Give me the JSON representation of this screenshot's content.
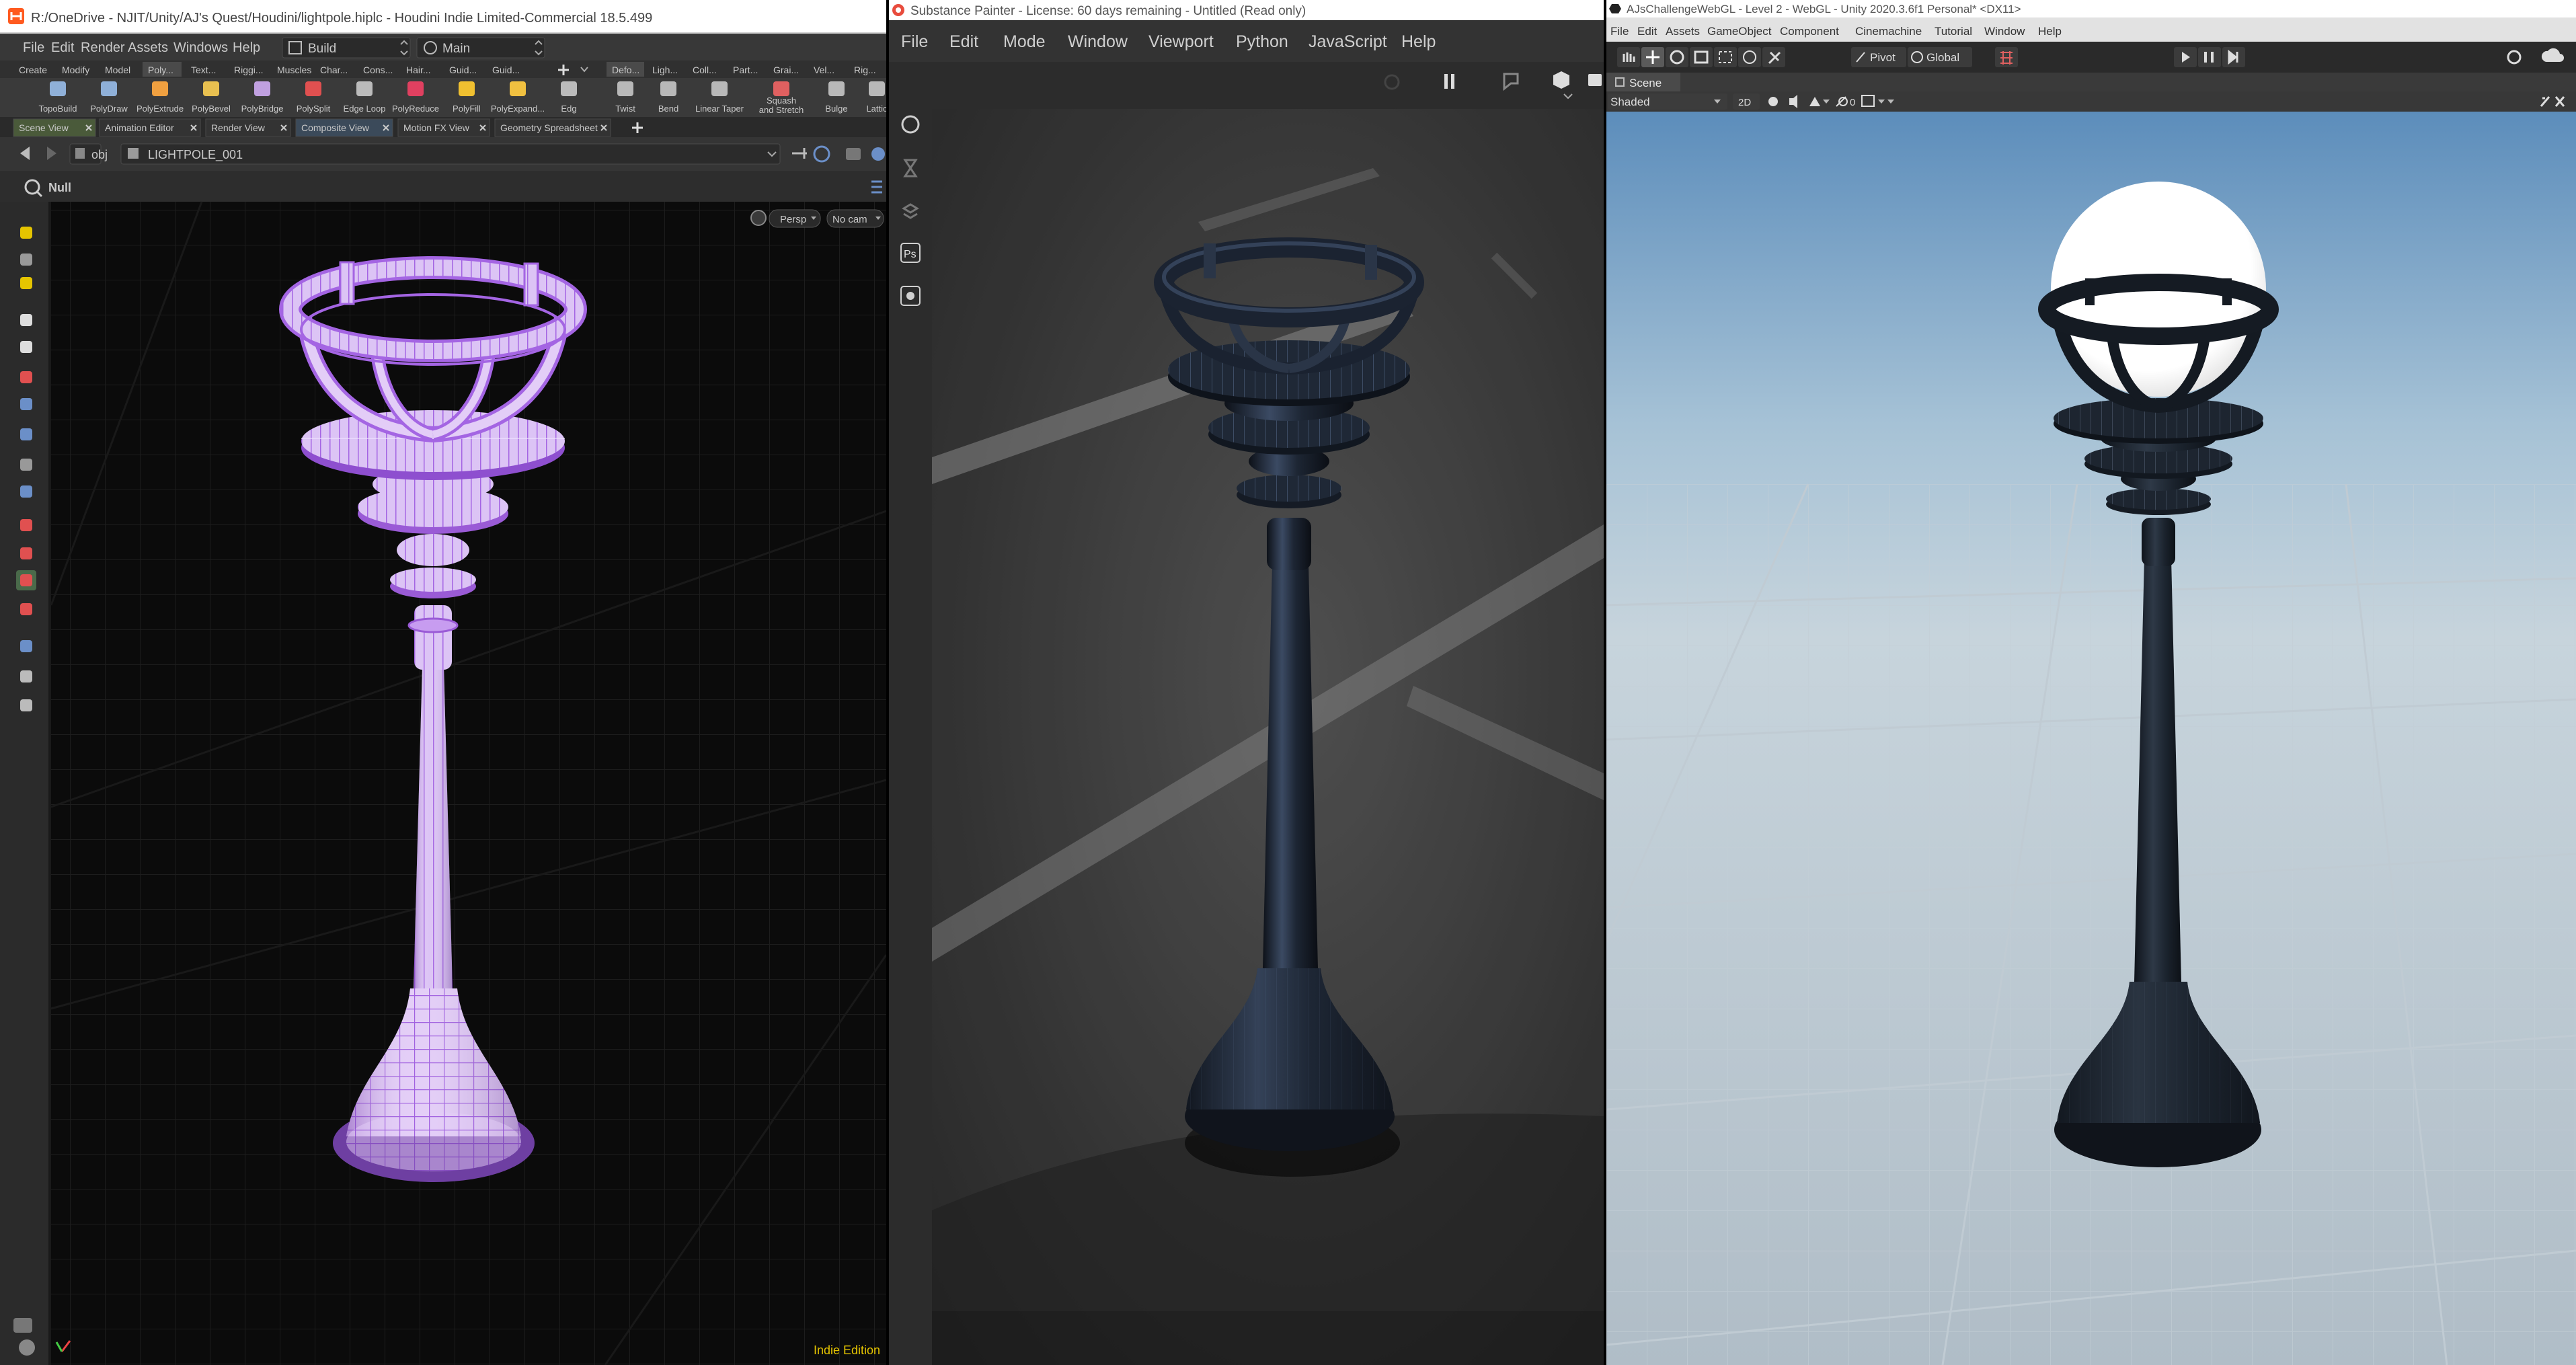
{
  "houdini": {
    "title": "R:/OneDrive - NJIT/Unity/AJ's Quest/Houdini/lightpole.hiplc - Houdini Indie Limited-Commercial 18.5.499",
    "menus": [
      "File",
      "Edit",
      "Render",
      "Assets",
      "Windows",
      "Help"
    ],
    "desktop": "Build",
    "context": "Main",
    "shelf_tabs_left": [
      "Create",
      "Modify",
      "Model",
      "Poly...",
      "Text...",
      "Riggi...",
      "Muscles",
      "Char...",
      "Cons...",
      "Hair...",
      "Guid...",
      "Guid..."
    ],
    "shelf_tabs_right": [
      "Defo...",
      "Ligh...",
      "Coll...",
      "Part...",
      "Grai...",
      "Vel...",
      "Rig..."
    ],
    "tools_left": [
      "TopoBuild",
      "PolyDraw",
      "PolyExtrude",
      "PolyBevel",
      "PolyBridge",
      "PolySplit",
      "Edge Loop",
      "PolyReduce",
      "PolyFill",
      "PolyExpand...",
      "Edg"
    ],
    "tools_right": [
      "Twist",
      "Bend",
      "Linear Taper",
      "Squash",
      "and Stretch",
      "Bulge",
      "Lattic"
    ],
    "pane_tabs": [
      "Scene View",
      "Animation Editor",
      "Render View",
      "Composite View",
      "Motion FX View",
      "Geometry Spreadsheet"
    ],
    "path_root": "obj",
    "path_node": "LIGHTPOLE_001",
    "tool_state": "Null",
    "camera_persp": "Persp",
    "camera_cam": "No cam",
    "edition": "Indie Edition"
  },
  "substance": {
    "title": "Substance Painter - License: 60 days remaining - Untitled (Read only)",
    "menus": [
      "File",
      "Edit",
      "Mode",
      "Window",
      "Viewport",
      "Python",
      "JavaScript",
      "Help"
    ],
    "side_tool_ps": "Ps"
  },
  "unity": {
    "title": "AJsChallengeWebGL - Level 2 - WebGL - Unity 2020.3.6f1 Personal* <DX11>",
    "menus": [
      "File",
      "Edit",
      "Assets",
      "GameObject",
      "Component",
      "Cinemachine",
      "Tutorial",
      "Window",
      "Help"
    ],
    "pivot": "Pivot",
    "global": "Global",
    "scene_tab": "Scene",
    "shading": "Shaded",
    "mode_2d": "2D",
    "hidden_count": "0"
  },
  "colors": {
    "houdini_wire": "#b97fe8",
    "houdini_bg": "#0b0b0b",
    "houdini_highlight": "#e5c400",
    "unity_sky": "#b8ccd9",
    "pole_dark": "#1c2430"
  }
}
